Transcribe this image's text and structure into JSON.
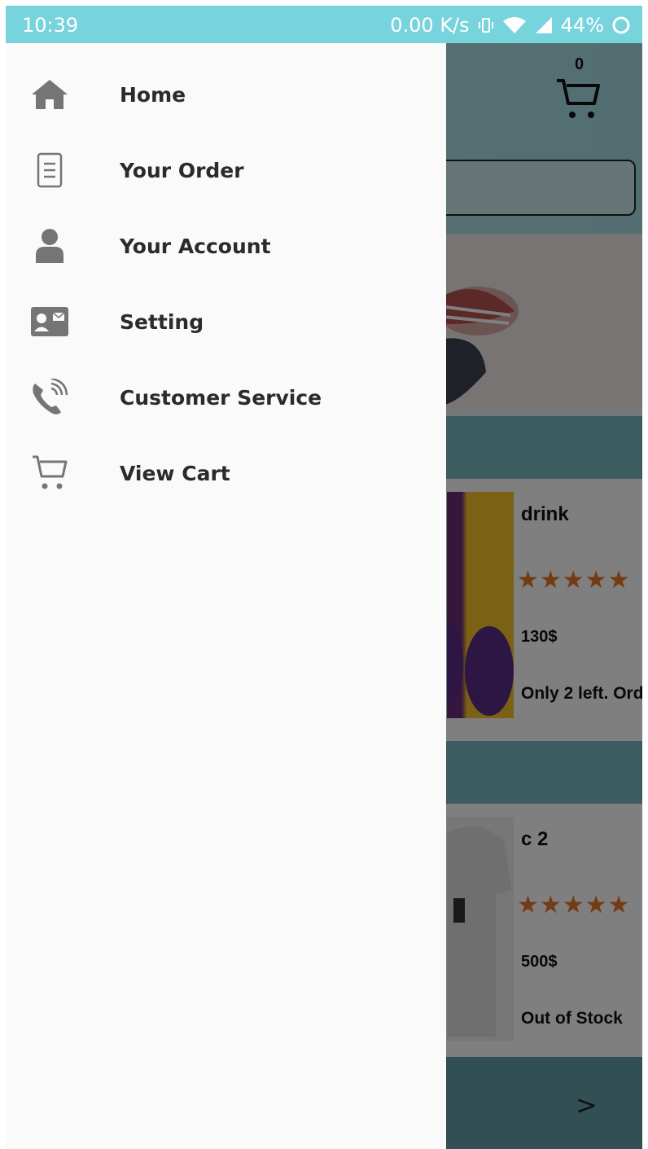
{
  "status_bar": {
    "time": "10:39",
    "network_speed": "0.00 K/s",
    "battery": "44%",
    "icons": [
      "vibrate-icon",
      "wifi-icon",
      "signal-icon",
      "battery-icon"
    ]
  },
  "header": {
    "cart_count": "0",
    "cart_icon": "cart-icon"
  },
  "products": [
    {
      "name": "drink",
      "rating": 4.5,
      "stars": "★★★★★",
      "price": "130$",
      "stock": "Only 2 left. Ord"
    },
    {
      "name": "c 2",
      "rating": 5,
      "stars": "★★★★★",
      "price": "500$",
      "stock": "Out of Stock"
    }
  ],
  "bottom_bar": {
    "next_label": ">"
  },
  "drawer": {
    "items": [
      {
        "label": "Home",
        "icon": "home-icon"
      },
      {
        "label": "Your Order",
        "icon": "order-document-icon"
      },
      {
        "label": "Your Account",
        "icon": "account-person-icon"
      },
      {
        "label": "Setting",
        "icon": "contact-card-icon"
      },
      {
        "label": "Customer Service",
        "icon": "phone-icon"
      },
      {
        "label": "View Cart",
        "icon": "cart-icon"
      }
    ]
  },
  "colors": {
    "status_bar": "#77d3dc",
    "drawer_bg": "#fafafa",
    "star": "#e9782a",
    "icon_gray": "#757575"
  }
}
